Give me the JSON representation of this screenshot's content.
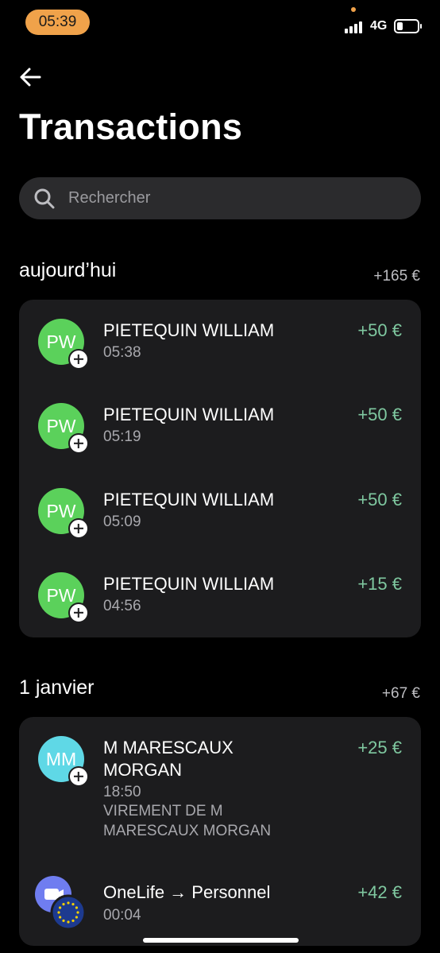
{
  "status": {
    "time": "05:39",
    "network": "4G",
    "battery_level": 0.3
  },
  "header": {
    "title": "Transactions"
  },
  "search": {
    "placeholder": "Rechercher"
  },
  "sections": [
    {
      "title": "aujourd’hui",
      "total": "+165 €",
      "items": [
        {
          "initials": "PW",
          "name": "PIETEQUIN WILLIAM",
          "time": "05:38",
          "amount": "+50 €"
        },
        {
          "initials": "PW",
          "name": "PIETEQUIN WILLIAM",
          "time": "05:19",
          "amount": "+50 €"
        },
        {
          "initials": "PW",
          "name": "PIETEQUIN WILLIAM",
          "time": "05:09",
          "amount": "+50 €"
        },
        {
          "initials": "PW",
          "name": "PIETEQUIN WILLIAM",
          "time": "04:56",
          "amount": "+15 €"
        }
      ]
    },
    {
      "title": "1 janvier",
      "total": "+67 €",
      "items": [
        {
          "initials": "MM",
          "name_line1": "M MARESCAUX",
          "name_line2": "MORGAN",
          "time": "18:50",
          "desc_line1": "VIREMENT DE M",
          "desc_line2": "MARESCAUX MORGAN",
          "amount": "+25 €"
        },
        {
          "name": "OneLife → Personnel",
          "time": "00:04",
          "amount": "+42 €"
        }
      ]
    }
  ],
  "colors": {
    "accent_amount": "#7fc8a0",
    "avatar_green": "#5bd15b",
    "avatar_cyan": "#5fd8e6",
    "time_pill": "#f0a24a"
  }
}
